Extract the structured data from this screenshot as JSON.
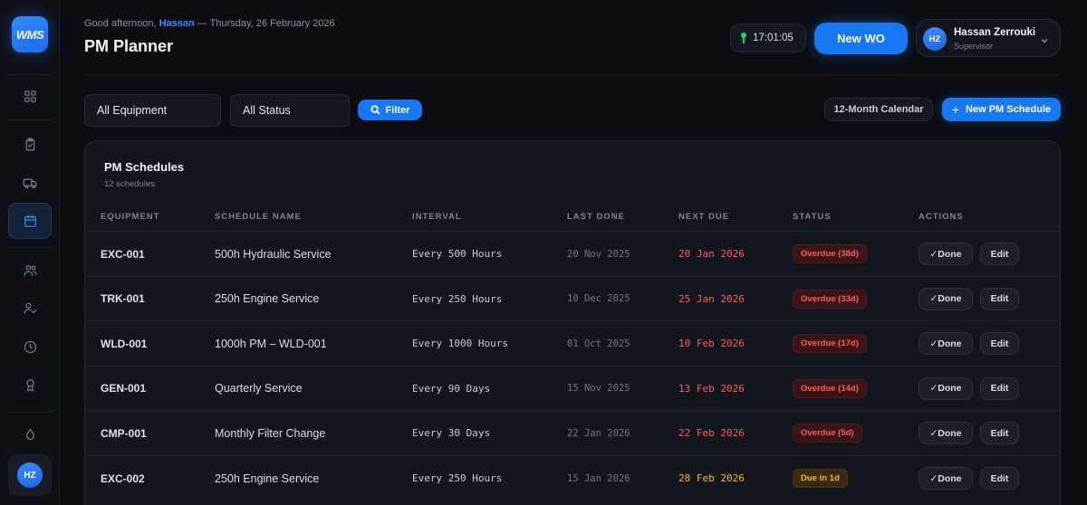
{
  "app": {
    "logo": "WMS"
  },
  "sidebar": {
    "items": [
      {
        "name": "dashboard",
        "icon": "grid-icon",
        "active": false
      },
      {
        "name": "work-orders",
        "icon": "clipboard-icon",
        "active": false
      },
      {
        "name": "equipment",
        "icon": "truck-icon",
        "active": false
      },
      {
        "name": "pm-planner",
        "icon": "calendar-icon",
        "active": true
      },
      {
        "name": "team",
        "icon": "users-icon",
        "active": false
      },
      {
        "name": "technicians",
        "icon": "user-check-icon",
        "active": false
      },
      {
        "name": "history",
        "icon": "clock-icon",
        "active": false
      },
      {
        "name": "certifications",
        "icon": "award-icon",
        "active": false
      },
      {
        "name": "fluids",
        "icon": "droplet-icon",
        "active": false
      }
    ],
    "avatar_initials": "HZ"
  },
  "header": {
    "greeting_prefix": "Good afternoon, ",
    "greeting_name": "Hassan",
    "greeting_date": " — Thursday, 26 February 2026",
    "title": "PM Planner",
    "clock": "17:01:05",
    "new_wo_label": "New WO",
    "user": {
      "initials": "HZ",
      "name": "Hassan Zerrouki",
      "role": "Supervisor"
    }
  },
  "toolbar": {
    "equipment_select": "All Equipment",
    "status_select": "All Status",
    "filter_label": "Filter",
    "calendar_label": "12-Month Calendar",
    "new_pm_label": "New PM Schedule"
  },
  "table": {
    "title": "PM Schedules",
    "subtitle": "12 schedules",
    "columns": [
      "EQUIPMENT",
      "SCHEDULE NAME",
      "INTERVAL",
      "LAST DONE",
      "NEXT DUE",
      "STATUS",
      "ACTIONS"
    ],
    "done_label": "✓Done",
    "edit_label": "Edit",
    "rows": [
      {
        "equipment": "EXC-001",
        "name": "500h Hydraulic Service",
        "interval": "Every 500 Hours",
        "last": "20 Nov 2025",
        "next": "20 Jan 2026",
        "status": "Overdue (38d)",
        "kind": "overdue"
      },
      {
        "equipment": "TRK-001",
        "name": "250h Engine Service",
        "interval": "Every 250 Hours",
        "last": "10 Dec 2025",
        "next": "25 Jan 2026",
        "status": "Overdue (33d)",
        "kind": "overdue"
      },
      {
        "equipment": "WLD-001",
        "name": "1000h PM – WLD-001",
        "interval": "Every 1000 Hours",
        "last": "01 Oct 2025",
        "next": "10 Feb 2026",
        "status": "Overdue (17d)",
        "kind": "overdue"
      },
      {
        "equipment": "GEN-001",
        "name": "Quarterly Service",
        "interval": "Every 90 Days",
        "last": "15 Nov 2025",
        "next": "13 Feb 2026",
        "status": "Overdue (14d)",
        "kind": "overdue"
      },
      {
        "equipment": "CMP-001",
        "name": "Monthly Filter Change",
        "interval": "Every 30 Days",
        "last": "22 Jan 2026",
        "next": "22 Feb 2026",
        "status": "Overdue (5d)",
        "kind": "overdue"
      },
      {
        "equipment": "EXC-002",
        "name": "250h Engine Service",
        "interval": "Every 250 Hours",
        "last": "15 Jan 2026",
        "next": "28 Feb 2026",
        "status": "Due in 1d",
        "kind": "due"
      }
    ]
  },
  "colors": {
    "accent": "#1877f2",
    "overdue": "#ff5a5a",
    "due": "#ffb02e"
  }
}
